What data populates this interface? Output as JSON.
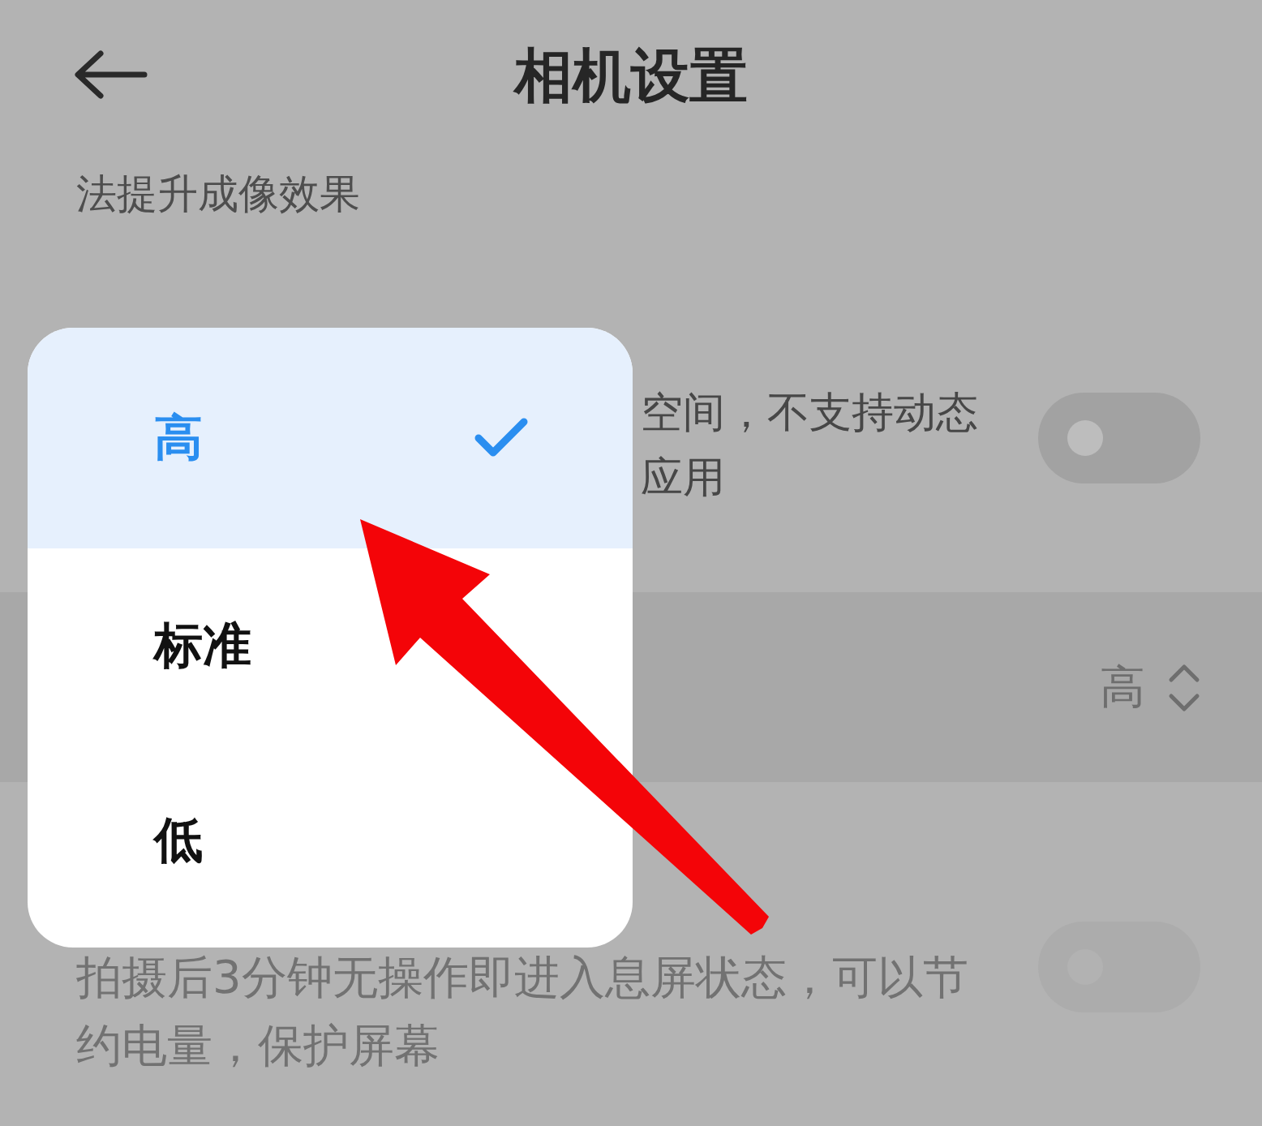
{
  "header": {
    "title": "相机设置"
  },
  "intro_text": "法提升成像效果",
  "settings": [
    {
      "kind": "toggle",
      "description_lines": [
        "空间，不支持动态",
        "应用"
      ],
      "on": false
    },
    {
      "kind": "select",
      "value": "高"
    },
    {
      "kind": "toggle",
      "description": "拍摄后3分钟无操作即进入息屏状态，可以节约电量，保护屏幕",
      "on": false
    }
  ],
  "dropdown": {
    "options": [
      {
        "label": "高",
        "selected": true
      },
      {
        "label": "标准",
        "selected": false
      },
      {
        "label": "低",
        "selected": false
      }
    ]
  }
}
